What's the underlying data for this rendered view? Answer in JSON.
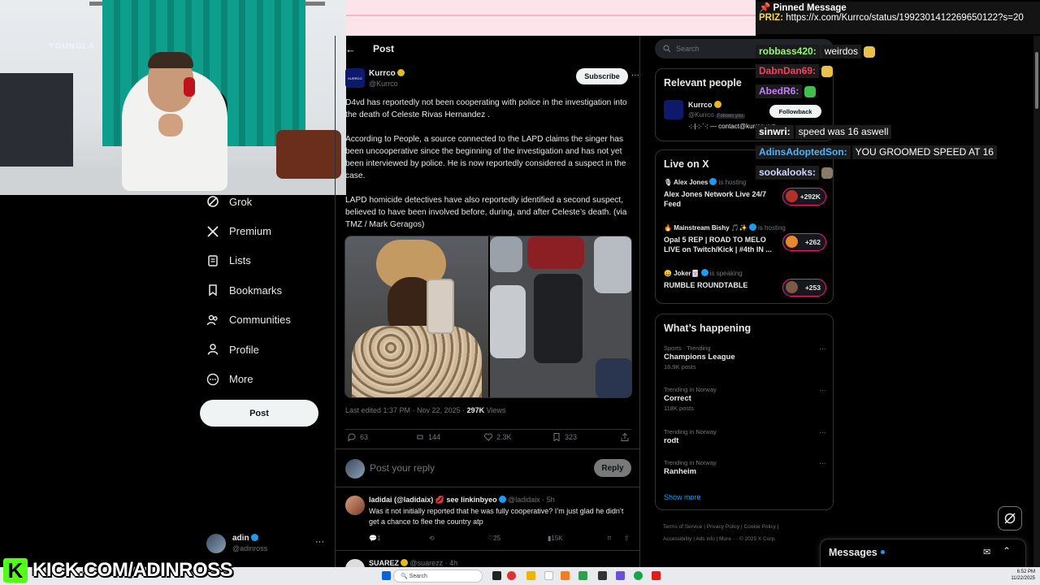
{
  "stream": {
    "banner_letter": "K",
    "banner_text": "KICK.COM/ADINROSS",
    "neon_sign": "YOUNGLA",
    "colors": {
      "kick_green": "#53fc18"
    }
  },
  "left_nav": {
    "items": [
      {
        "label": "Grok",
        "icon": "grok-icon"
      },
      {
        "label": "Premium",
        "icon": "x-logo-icon"
      },
      {
        "label": "Lists",
        "icon": "list-icon"
      },
      {
        "label": "Bookmarks",
        "icon": "bookmark-icon"
      },
      {
        "label": "Communities",
        "icon": "people-icon"
      },
      {
        "label": "Profile",
        "icon": "person-icon"
      },
      {
        "label": "More",
        "icon": "more-circle-icon"
      }
    ],
    "post_button": "Post",
    "account": {
      "name": "adin",
      "handle": "@adinross",
      "more": "···"
    }
  },
  "post": {
    "back": "←",
    "header": "Post",
    "author": {
      "name": "Kurrco",
      "handle": "@Kurrco",
      "logo_text": "KURRCO"
    },
    "subscribe": "Subscribe",
    "more": "···",
    "paragraphs": [
      "D4vd has reportedly not been cooperating with police in the investigation into the death of Celeste Rivas Hernandez .",
      "According to People, a source connected to the LAPD claims the singer has been uncooperative since the beginning of the investigation and has not yet been interviewed by police. He is now reportedly considered a suspect in the case.",
      "LAPD homicide detectives have also reportedly identified a second suspect, believed to have been involved before, during, and after Celeste’s death. (via TMZ / Mark Geragos)"
    ],
    "meta_prefix": "Last edited 1:37 PM · Nov 22, 2025 · ",
    "views_count": "297K",
    "views_label": " Views",
    "stats": {
      "replies": "63",
      "reposts": "144",
      "likes": "2.3K",
      "bookmarks": "323"
    }
  },
  "reply_box": {
    "placeholder": "Post your reply",
    "button": "Reply"
  },
  "replies": [
    {
      "name": "ladidai (@ladidaix)",
      "badge": "see linkinbyeo",
      "handle_time": "@ladidaix · 5h",
      "text": "Was it not initially reported that he was fully cooperative? I’m just glad he didn’t get a chance to flee the country atp",
      "replies": "1",
      "likes": "25",
      "views": "15K"
    },
    {
      "name": "SUAREZ",
      "handle_time": "@suarezz · 4h"
    }
  ],
  "right_sidebar": {
    "search_placeholder": "Search",
    "relevant_people": {
      "title": "Relevant people",
      "name": "Kurrco",
      "handle": "@Kurrco",
      "follows_you": "Follows you",
      "bio": "·:·|·:·`·: — contact@kurrco.xyz",
      "follow_back": "Followback"
    },
    "live_on_x": {
      "title": "Live on X",
      "items": [
        {
          "host": "Alex Jones",
          "status": "is hosting",
          "title": "Alex Jones Network Live 24/7 Feed",
          "count": "+292K"
        },
        {
          "host": "Mainstream Bishy 🎵✨",
          "status": "is hosting",
          "title": "Opal 5 REP | ROAD TO MELO LIVE on Twitch/Kick | #4th IN ...",
          "count": "+262"
        },
        {
          "host": "Joker🃏",
          "status": "is speaking",
          "title": "RUMBLE ROUNDTABLE",
          "count": "+253"
        }
      ]
    },
    "whats_happening": {
      "title": "What’s happening",
      "trends": [
        {
          "context": "Sports · Trending",
          "name": "Champions League",
          "count": "16.9K posts"
        },
        {
          "context": "Trending in Norway",
          "name": "Correct",
          "count": "118K posts"
        },
        {
          "context": "Trending in Norway",
          "name": "rodt",
          "count": ""
        },
        {
          "context": "Trending in Norway",
          "name": "Ranheim",
          "count": ""
        }
      ],
      "show_more": "Show more",
      "dots": "···"
    },
    "footer": {
      "line1": "Terms of Service  |  Privacy Policy  |  Cookie Policy  |",
      "line2": "Accessibility  |  Ads info  |  More ···  © 2025 X Corp."
    }
  },
  "chat": {
    "pinned_title": "Pinned Message",
    "pinned_user": "PRIZ:",
    "pinned_url": "https://x.com/Kurrco/status/1992301412269650122?s=20",
    "lines": [
      {
        "user": "robbass420:",
        "message": "weirdos",
        "color": "#8dff6a"
      },
      {
        "user": "DabnDan69:",
        "message": "",
        "color": "#ff3b5c"
      },
      {
        "user": "AbedR6:",
        "message": "",
        "color": "#c77dff"
      },
      {
        "user": "sinwri:",
        "message": "speed was 16 aswell",
        "color": "#ffffff"
      },
      {
        "user": "AdinsAdoptedSon:",
        "message": "YOU GROOMED SPEED AT 16",
        "color": "#4fb3ff"
      },
      {
        "user": "sookalooks:",
        "message": "",
        "color": "#cfd6ff"
      }
    ]
  },
  "messages_drawer": {
    "title": "Messages"
  },
  "taskbar": {
    "search": "Search",
    "time": "6:52 PM",
    "date": "11/22/2025"
  }
}
